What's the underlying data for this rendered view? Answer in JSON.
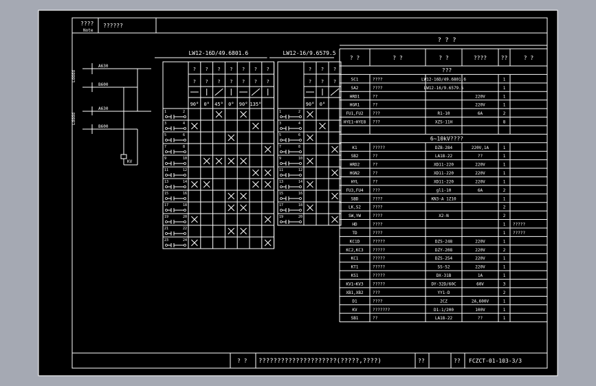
{
  "note_header": {
    "label": "????",
    "sublabel": "Note",
    "text": "??????"
  },
  "sw1": {
    "title": "LW12-16D/49.6801.6",
    "pos_row1": [
      "?",
      "?",
      "?",
      "?",
      "?",
      "?",
      "?"
    ],
    "pos_row2": [
      "?",
      "?",
      "?",
      "?",
      "?",
      "?",
      "?"
    ],
    "angles": [
      "90°",
      "0°",
      "45°",
      "0°",
      "90°",
      "135°"
    ],
    "rows": [
      {
        "a": "1",
        "b": "2",
        "marks": [
          0,
          0,
          1,
          0,
          1,
          0,
          0
        ]
      },
      {
        "a": "3",
        "b": "4",
        "marks": [
          1,
          0,
          0,
          0,
          0,
          1,
          0
        ]
      },
      {
        "a": "5",
        "b": "6",
        "marks": [
          0,
          0,
          0,
          1,
          0,
          0,
          0
        ]
      },
      {
        "a": "7",
        "b": "8",
        "marks": [
          0,
          0,
          0,
          0,
          0,
          0,
          1
        ]
      },
      {
        "a": "9",
        "b": "10",
        "marks": [
          0,
          1,
          1,
          1,
          1,
          0,
          0
        ]
      },
      {
        "a": "11",
        "b": "12",
        "marks": [
          0,
          0,
          0,
          0,
          0,
          1,
          1
        ]
      },
      {
        "a": "13",
        "b": "14",
        "marks": [
          1,
          1,
          0,
          0,
          0,
          1,
          1
        ]
      },
      {
        "a": "15",
        "b": "16",
        "marks": [
          0,
          0,
          0,
          1,
          1,
          0,
          0
        ]
      },
      {
        "a": "17",
        "b": "18",
        "marks": [
          0,
          0,
          0,
          1,
          1,
          0,
          0
        ]
      },
      {
        "a": "19",
        "b": "20",
        "marks": [
          1,
          0,
          0,
          0,
          0,
          0,
          1
        ]
      },
      {
        "a": "21",
        "b": "22",
        "marks": [
          0,
          0,
          0,
          1,
          1,
          0,
          0
        ]
      },
      {
        "a": "23",
        "b": "24",
        "marks": [
          1,
          0,
          0,
          0,
          0,
          0,
          1
        ]
      }
    ]
  },
  "sw2": {
    "title": "LW12-16/9.6579.5",
    "pos_row1": [
      "?",
      "?",
      "?"
    ],
    "pos_row2": [
      "?",
      "?",
      "?"
    ],
    "angles": [
      "90°",
      "0°"
    ],
    "rows": [
      {
        "a": "1",
        "b": "2",
        "marks": [
          1,
          0,
          0
        ]
      },
      {
        "a": "3",
        "b": "4",
        "marks": [
          0,
          1,
          0
        ]
      },
      {
        "a": "5",
        "b": "6",
        "marks": [
          1,
          0,
          0
        ]
      },
      {
        "a": "7",
        "b": "8",
        "marks": [
          0,
          0,
          1
        ]
      },
      {
        "a": "9",
        "b": "10",
        "marks": [
          1,
          0,
          0
        ]
      },
      {
        "a": "11",
        "b": "12",
        "marks": [
          0,
          0,
          1
        ]
      },
      {
        "a": "13",
        "b": "14",
        "marks": [
          1,
          0,
          0
        ]
      },
      {
        "a": "15",
        "b": "16",
        "marks": [
          0,
          0,
          1
        ]
      },
      {
        "a": "17",
        "b": "18",
        "marks": [
          1,
          0,
          0
        ]
      },
      {
        "a": "19",
        "b": "20",
        "marks": [
          0,
          0,
          1
        ]
      }
    ]
  },
  "circuit": {
    "labels": [
      "A630",
      "B600",
      "A630",
      "B600",
      "KV"
    ]
  },
  "equip": {
    "title": "? ? ?",
    "headers": [
      "? ?",
      "? ?",
      "? ?",
      "????",
      "??",
      "? ?"
    ],
    "section1": "???",
    "rows1": [
      [
        "SC1",
        "????",
        "LW12-16D/49.6801.6",
        "",
        "1",
        ""
      ],
      [
        "SA2",
        "????",
        "LW12-16/9.6579.5",
        "",
        "1",
        ""
      ],
      [
        "HRD1",
        "??",
        "",
        "220V",
        "1",
        ""
      ],
      [
        "HGR1",
        "??",
        "",
        "220V",
        "1",
        ""
      ],
      [
        "FU1,FU2",
        "???",
        "R1-10",
        "6A",
        "2",
        ""
      ],
      [
        "HYE1~HYE8",
        "???",
        "XZS-11H",
        "",
        "8",
        ""
      ],
      [
        "",
        "",
        "",
        "",
        "",
        ""
      ]
    ],
    "section2": "6~10kV????",
    "rows2": [
      [
        "K1",
        "?????",
        "DZB-284",
        "220V,1A",
        "1",
        ""
      ],
      [
        "SB2",
        "??",
        "LA18-22",
        "??",
        "1",
        ""
      ],
      [
        "HRD2",
        "??",
        "XD11-220",
        "220V",
        "1",
        ""
      ],
      [
        "HGN2",
        "??",
        "XD11-220",
        "220V",
        "1",
        ""
      ],
      [
        "HYL",
        "??",
        "XD11-220",
        "220V",
        "1",
        ""
      ],
      [
        "FU3,FU4",
        "???",
        "gl1-10",
        "6A",
        "2",
        ""
      ],
      [
        "SBD",
        "????",
        "KN3-A 1Z10",
        "",
        "1",
        ""
      ],
      [
        "LK,S2",
        "????",
        "",
        "",
        "2",
        ""
      ],
      [
        "SW,YW",
        "????",
        "X2-N",
        "",
        "2",
        ""
      ],
      [
        "HD",
        "????",
        "",
        "",
        "1",
        "?????"
      ],
      [
        "TD",
        "????",
        "",
        "",
        "1",
        "?????"
      ],
      [
        "KC1D",
        "?????",
        "DZS-248",
        "220V",
        "1",
        ""
      ],
      [
        "KC2,KC3",
        "?????",
        "DZY-208",
        "220V",
        "2",
        ""
      ],
      [
        "KC1",
        "?????",
        "DZS-254",
        "220V",
        "1",
        ""
      ],
      [
        "KT1",
        "?????",
        "SS-52",
        "220V",
        "1",
        ""
      ],
      [
        "KS1",
        "?????",
        "DX-31B",
        "1A",
        "1",
        ""
      ],
      [
        "KV1~KV3",
        "?????",
        "DY-32D/60C",
        "60V",
        "3",
        ""
      ],
      [
        "XB1,XB2",
        "???",
        "YY1-D",
        "",
        "2",
        ""
      ],
      [
        "D1",
        "????",
        "2CZ",
        "2A,600V",
        "1",
        ""
      ],
      [
        "KV",
        "???????",
        "D1-1/200",
        "100V",
        "1",
        ""
      ],
      [
        "SB1",
        "??",
        "LA18-22",
        "??",
        "1",
        ""
      ]
    ]
  },
  "title_block": {
    "left": "? ?",
    "main": "?????????????????????(?????,????)",
    "mid1": "??",
    "mid2": "??",
    "code": "FCZCT-01-103-3/3"
  }
}
